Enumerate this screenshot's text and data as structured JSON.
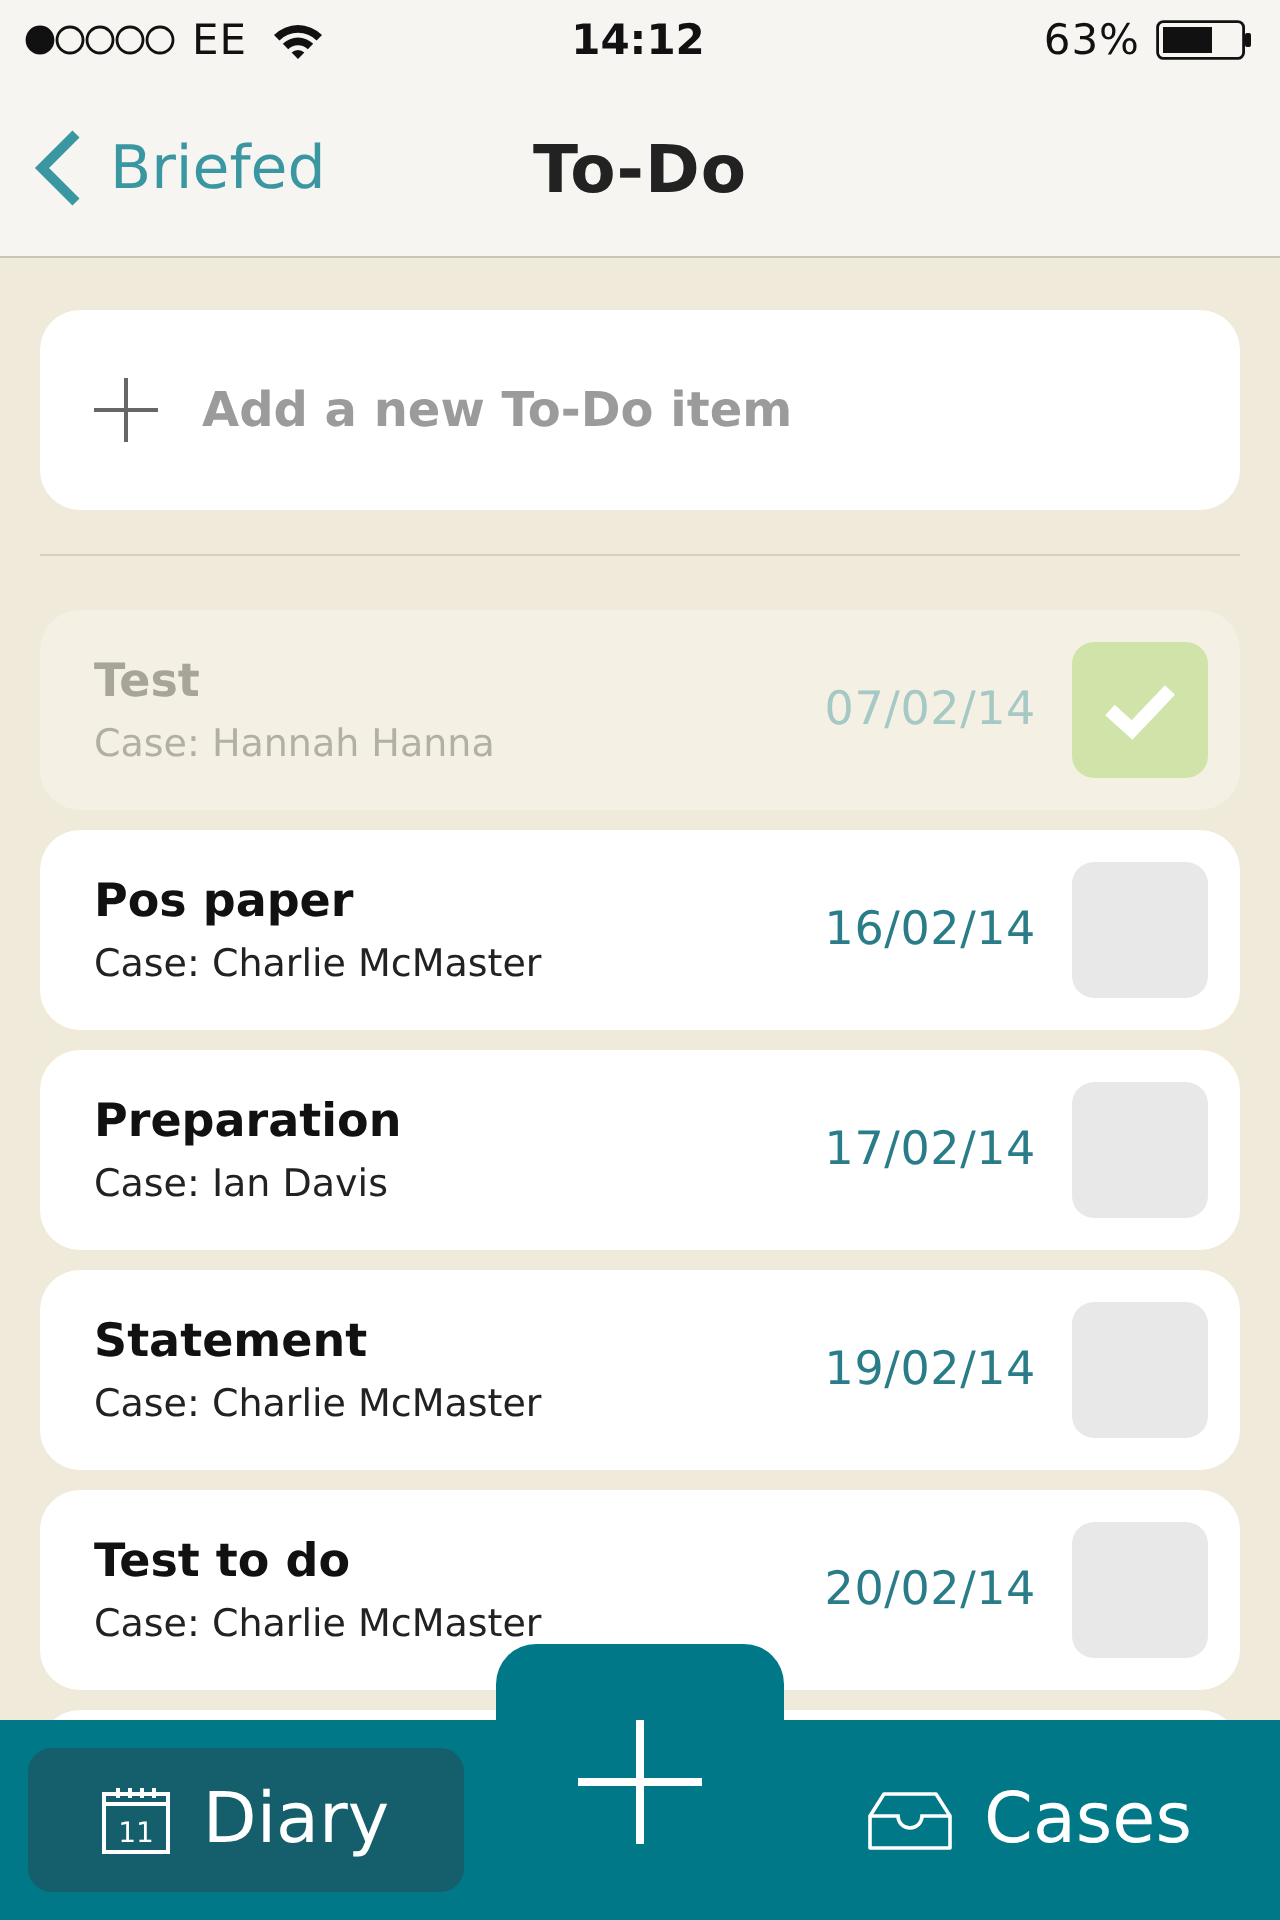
{
  "status_bar": {
    "carrier": "EE",
    "time": "14:12",
    "battery": "63%"
  },
  "nav_bar": {
    "back": "Briefed",
    "title": "To-Do"
  },
  "add_item": {
    "placeholder": "Add a new To-Do item"
  },
  "todos": [
    {
      "title": "Test",
      "case": "Case: Hannah Hanna",
      "date": "07/02/14",
      "checked": true
    },
    {
      "title": "Pos paper",
      "case": "Case: Charlie McMaster",
      "date": "16/02/14",
      "checked": false
    },
    {
      "title": "Preparation",
      "case": "Case: Ian Davis",
      "date": "17/02/14",
      "checked": false
    },
    {
      "title": "Statement",
      "case": "Case: Charlie McMaster",
      "date": "19/02/14",
      "checked": false
    },
    {
      "title": "Test to do",
      "case": "Case: Charlie McMaster",
      "date": "20/02/14",
      "checked": false
    }
  ],
  "tab_bar": {
    "tabs": [
      {
        "kind": "calendar",
        "label": "Diary",
        "day": "11",
        "selected": true
      },
      {
        "kind": "inbox",
        "label": "Cases",
        "selected": false
      }
    ]
  }
}
